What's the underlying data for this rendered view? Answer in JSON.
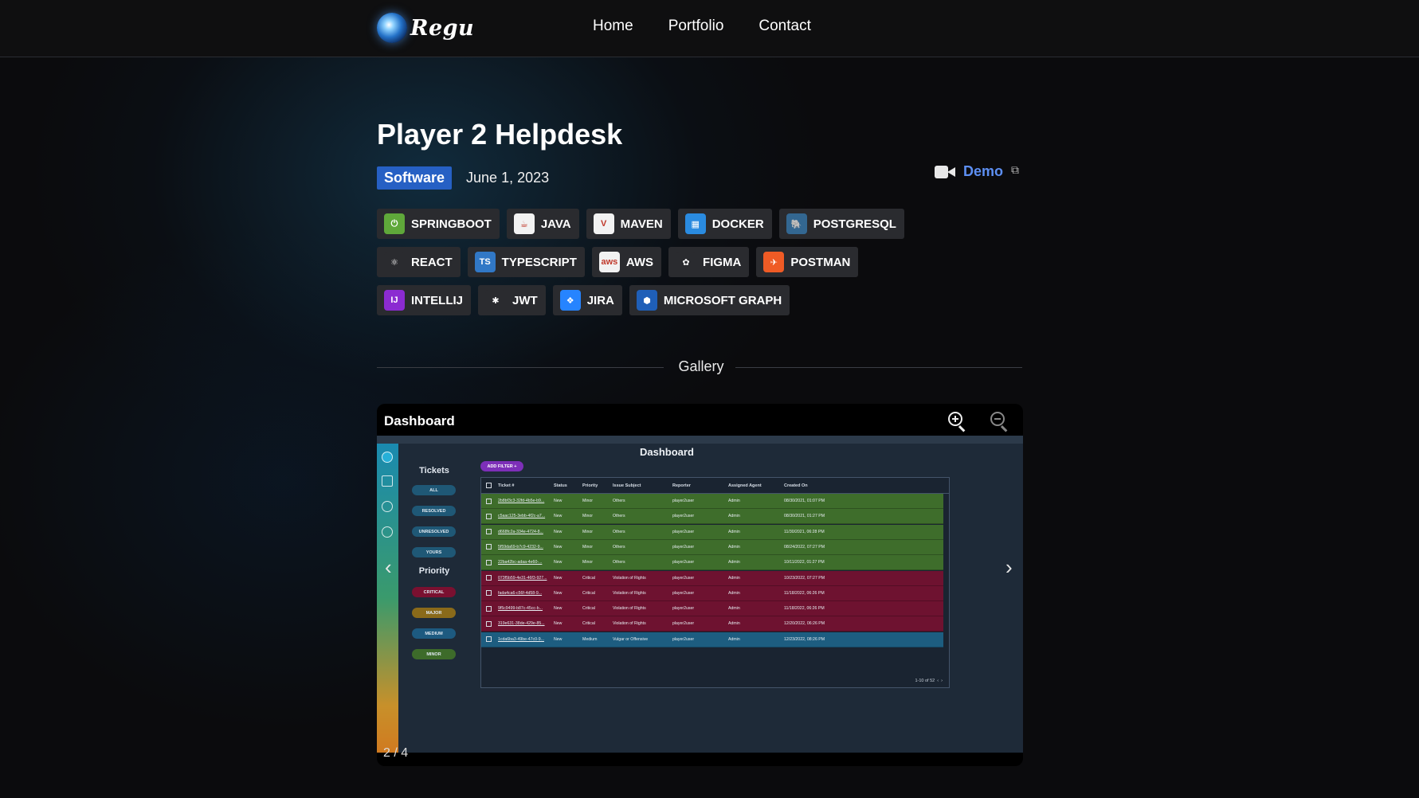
{
  "nav": {
    "brand": "Regu",
    "links": [
      "Home",
      "Portfolio",
      "Contact"
    ]
  },
  "project": {
    "title": "Player 2 Helpdesk",
    "category": "Software",
    "date": "June 1, 2023",
    "demo_label": "Demo"
  },
  "technologies": [
    {
      "label": "SPRINGBOOT",
      "icon": "springboot-icon",
      "color": "#5fa83a",
      "glyph": "⏻"
    },
    {
      "label": "JAVA",
      "icon": "java-icon",
      "color": "#f2f2f2",
      "glyph": "☕"
    },
    {
      "label": "MAVEN",
      "icon": "maven-icon",
      "color": "#f2f2f2",
      "glyph": "V"
    },
    {
      "label": "DOCKER",
      "icon": "docker-icon",
      "color": "#2a8be0",
      "glyph": "▦"
    },
    {
      "label": "POSTGRESQL",
      "icon": "postgresql-icon",
      "color": "#336791",
      "glyph": "🐘"
    },
    {
      "label": "REACT",
      "icon": "react-icon",
      "color": "#2a2b2f",
      "glyph": "⚛"
    },
    {
      "label": "TYPESCRIPT",
      "icon": "typescript-icon",
      "color": "#3178c6",
      "glyph": "TS"
    },
    {
      "label": "AWS",
      "icon": "aws-icon",
      "color": "#f2f2f2",
      "glyph": "aws"
    },
    {
      "label": "FIGMA",
      "icon": "figma-icon",
      "color": "#2a2b2f",
      "glyph": "✿"
    },
    {
      "label": "POSTMAN",
      "icon": "postman-icon",
      "color": "#ef5b25",
      "glyph": "✈"
    },
    {
      "label": "INTELLIJ",
      "icon": "intellij-icon",
      "color": "#8b2bd1",
      "glyph": "IJ"
    },
    {
      "label": "JWT",
      "icon": "jwt-icon",
      "color": "#2a2b2f",
      "glyph": "✱"
    },
    {
      "label": "JIRA",
      "icon": "jira-icon",
      "color": "#2684ff",
      "glyph": "❖"
    },
    {
      "label": "MICROSOFT GRAPH",
      "icon": "microsoft-graph-icon",
      "color": "#1f5fb8",
      "glyph": "⬢"
    }
  ],
  "gallery": {
    "heading": "Gallery",
    "slide_title": "Dashboard",
    "counter": "2 / 4"
  },
  "screenshot": {
    "heading": "Dashboard",
    "tickets_heading": "Tickets",
    "ticket_filters": [
      "ALL",
      "RESOLVED",
      "UNRESOLVED",
      "YOURS"
    ],
    "priority_heading": "Priority",
    "priority_filters": [
      {
        "label": "CRITICAL",
        "color": "#7a1030"
      },
      {
        "label": "MAJOR",
        "color": "#8a6a1a"
      },
      {
        "label": "MEDIUM",
        "color": "#1d5a80"
      },
      {
        "label": "MINOR",
        "color": "#3d6b2a"
      }
    ],
    "add_filter": "ADD FILTER +",
    "columns": [
      "Ticket #",
      "Status",
      "Priority",
      "Issue Subject",
      "Reporter",
      "Assigned Agent",
      "Created On"
    ],
    "rows": [
      {
        "id": "2b8bf3c3-32fd-4b5e-b9...",
        "status": "New",
        "priority": "Minor",
        "subject": "Others",
        "reporter": "player2user",
        "agent": "Admin",
        "created": "08/30/2021, 01:07 PM",
        "color": "#3e6d2b"
      },
      {
        "id": "c5aac125-3ebb-4f2c-a7...",
        "status": "New",
        "priority": "Minor",
        "subject": "Others",
        "reporter": "player2user",
        "agent": "Admin",
        "created": "08/30/2021, 01:27 PM",
        "color": "#3e6d2b"
      },
      {
        "id": "d668fc2a-334e-4724-8...",
        "status": "New",
        "priority": "Minor",
        "subject": "Others",
        "reporter": "player2user",
        "agent": "Admin",
        "created": "11/30/2021, 06:28 PM",
        "color": "#3e6d2b"
      },
      {
        "id": "5f59da69-b7c9-4232-9...",
        "status": "New",
        "priority": "Minor",
        "subject": "Others",
        "reporter": "player2user",
        "agent": "Admin",
        "created": "08/24/2022, 07:27 PM",
        "color": "#3e6d2b"
      },
      {
        "id": "22ba42bc-adaa-4e60-...",
        "status": "New",
        "priority": "Minor",
        "subject": "Others",
        "reporter": "player2user",
        "agent": "Admin",
        "created": "10/11/2022, 01:27 PM",
        "color": "#3e6d2b"
      },
      {
        "id": "073f5b59-4e31-46f3-927...",
        "status": "New",
        "priority": "Critical",
        "subject": "Violation of Rights",
        "reporter": "player2user",
        "agent": "Admin",
        "created": "10/23/2022, 07:27 PM",
        "color": "#6e1230"
      },
      {
        "id": "fada4ca6-c56f-4d58-9...",
        "status": "New",
        "priority": "Critical",
        "subject": "Violation of Rights",
        "reporter": "player2user",
        "agent": "Admin",
        "created": "11/18/2022, 06:26 PM",
        "color": "#6e1230"
      },
      {
        "id": "9f5c9499-b87c-45cc-b...",
        "status": "New",
        "priority": "Critical",
        "subject": "Violation of Rights",
        "reporter": "player2user",
        "agent": "Admin",
        "created": "11/18/2022, 06:26 PM",
        "color": "#6e1230"
      },
      {
        "id": "319e631-38de-429e-85...",
        "status": "New",
        "priority": "Critical",
        "subject": "Violation of Rights",
        "reporter": "player2user",
        "agent": "Admin",
        "created": "12/20/2022, 06:26 PM",
        "color": "#6e1230"
      },
      {
        "id": "1cda6ba3-49be-47c0-9...",
        "status": "New",
        "priority": "Medium",
        "subject": "Vulgar or Offensive",
        "reporter": "player2user",
        "agent": "Admin",
        "created": "12/23/2022, 08:26 PM",
        "color": "#1d5d80"
      }
    ],
    "pager": "1-10 of 52"
  }
}
